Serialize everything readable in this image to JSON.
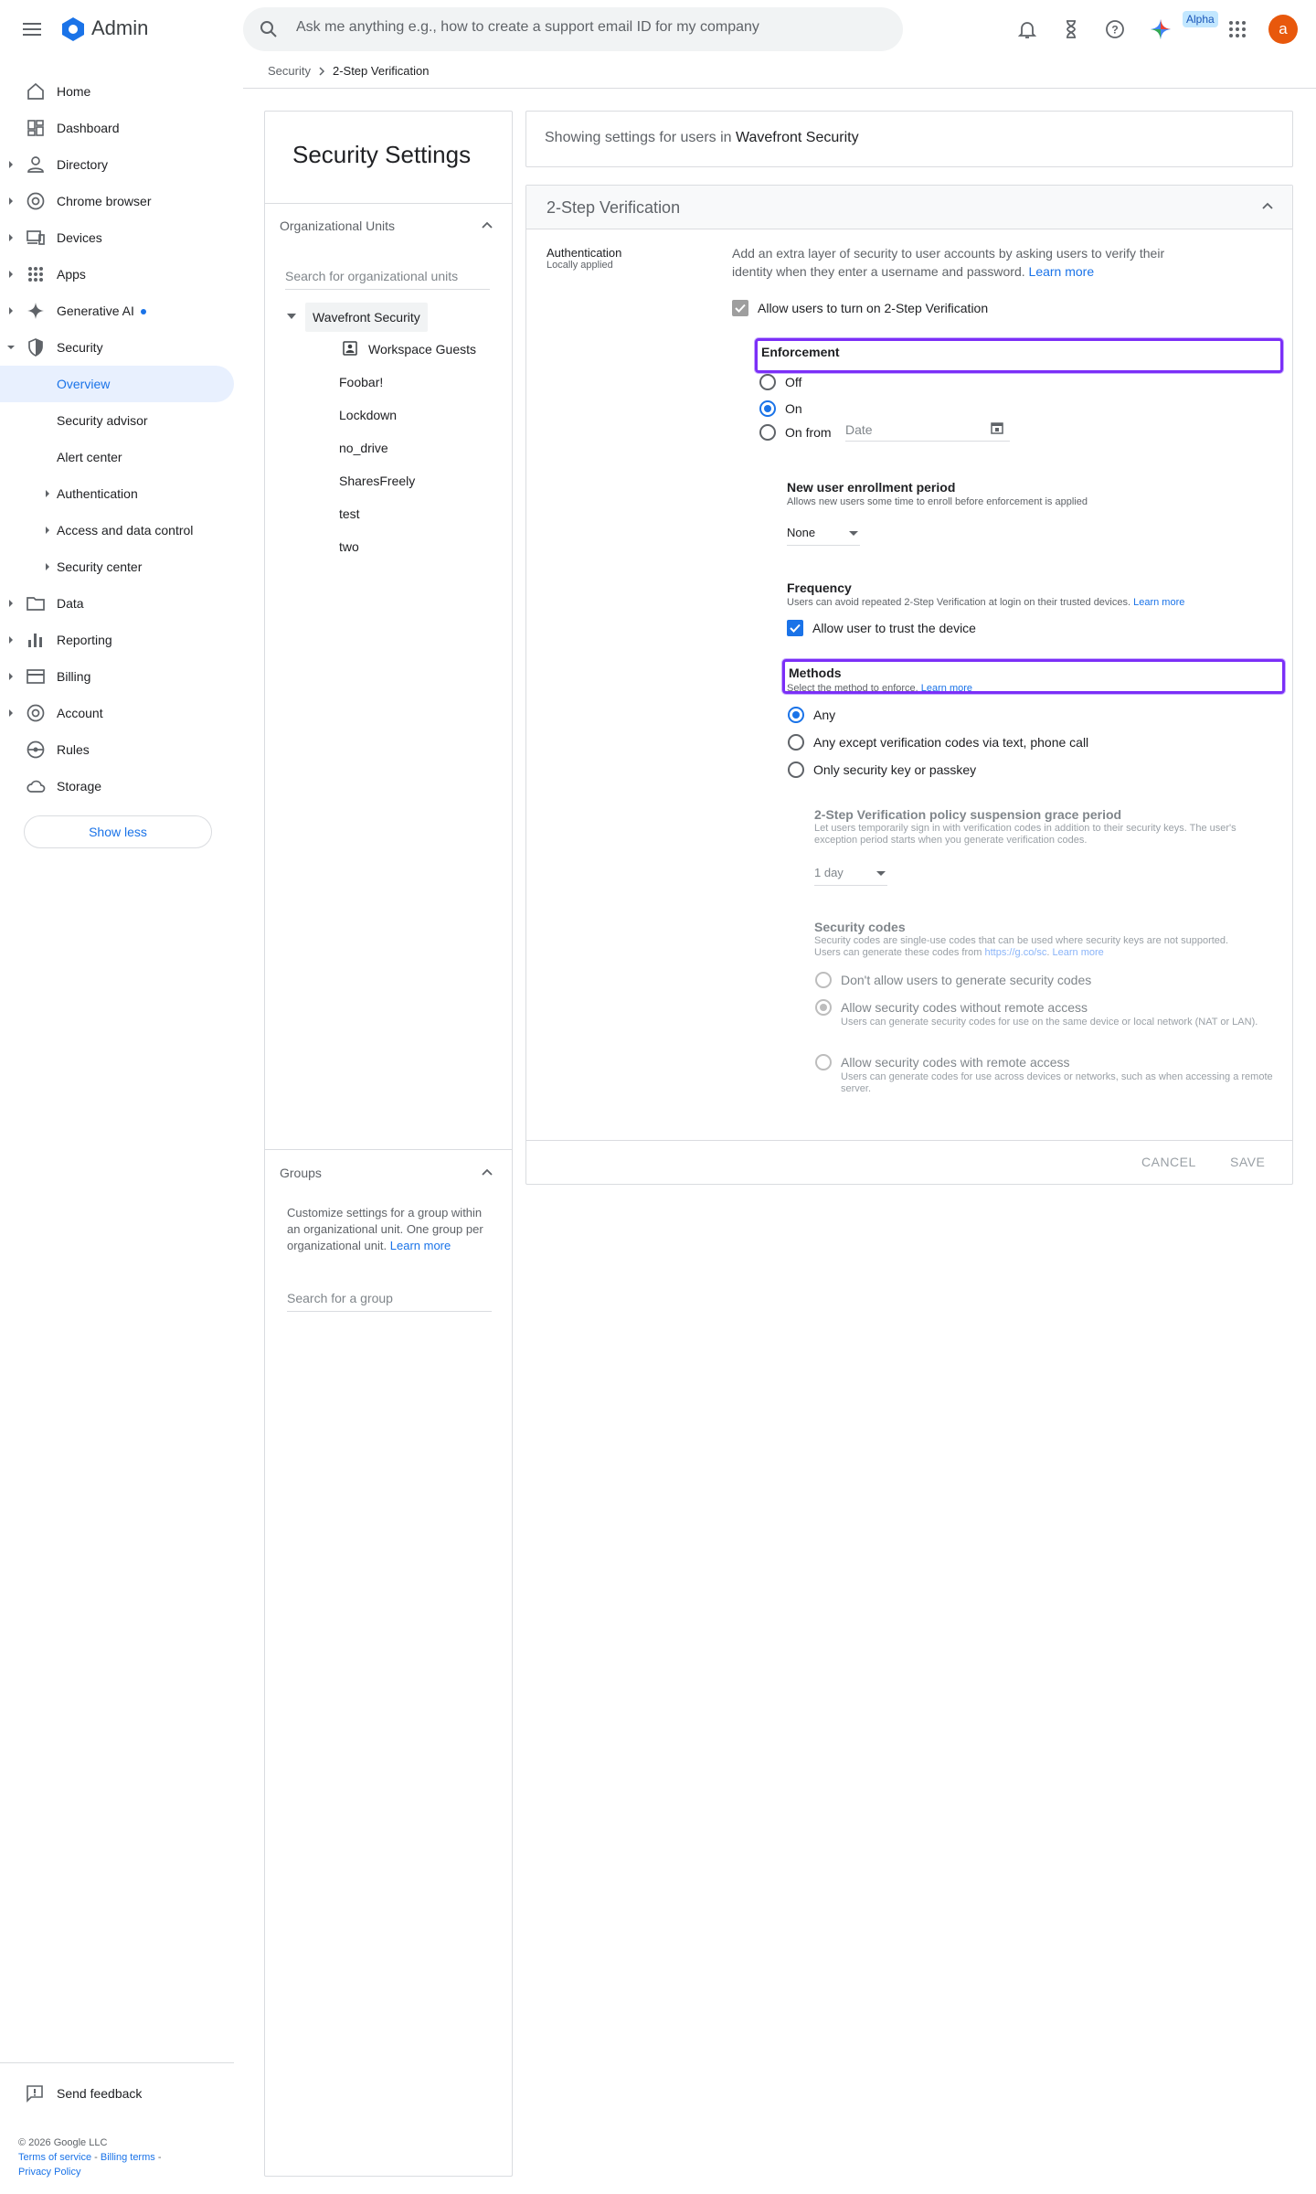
{
  "topbar": {
    "app_title": "Admin",
    "search_placeholder": "Ask me anything e.g., how to create a support email ID for my company",
    "alpha_badge": "Alpha",
    "avatar_letter": "a"
  },
  "breadcrumb": {
    "parent": "Security",
    "current": "2-Step Verification"
  },
  "sidebar": {
    "items": [
      {
        "label": "Home",
        "icon": "home-icon"
      },
      {
        "label": "Dashboard",
        "icon": "dashboard-icon"
      },
      {
        "label": "Directory",
        "icon": "person-icon"
      },
      {
        "label": "Chrome browser",
        "icon": "chrome-icon"
      },
      {
        "label": "Devices",
        "icon": "devices-icon"
      },
      {
        "label": "Apps",
        "icon": "apps-icon"
      },
      {
        "label": "Generative AI",
        "icon": "sparkle-icon"
      },
      {
        "label": "Security",
        "icon": "shield-icon"
      },
      {
        "label": "Overview"
      },
      {
        "label": "Security advisor"
      },
      {
        "label": "Alert center"
      },
      {
        "label": "Authentication"
      },
      {
        "label": "Access and data control"
      },
      {
        "label": "Security center"
      },
      {
        "label": "Data",
        "icon": "folder-icon"
      },
      {
        "label": "Reporting",
        "icon": "bar-chart-icon"
      },
      {
        "label": "Billing",
        "icon": "credit-card-icon"
      },
      {
        "label": "Account",
        "icon": "at-icon"
      },
      {
        "label": "Rules",
        "icon": "steering-icon"
      },
      {
        "label": "Storage",
        "icon": "cloud-icon"
      }
    ],
    "show_less": "Show less",
    "send_feedback": "Send feedback",
    "copyright": "© 2026 Google LLC",
    "terms": "Terms of service",
    "billing_terms": "Billing terms",
    "privacy": "Privacy Policy"
  },
  "ou_panel": {
    "title": "Security Settings",
    "ou_header": "Organizational Units",
    "search_placeholder": "Search for organizational units",
    "root": "Wavefront Security",
    "children": [
      "Workspace Guests",
      "Foobar!",
      "Lockdown",
      "no_drive",
      "SharesFreely",
      "test",
      "two"
    ],
    "groups_header": "Groups",
    "groups_text": "Customize settings for a group within an organizational unit. One group per organizational unit.",
    "groups_learn_more": "Learn more",
    "group_search_placeholder": "Search for a group"
  },
  "main": {
    "showing_prefix": "Showing settings for users in",
    "showing_ou": "Wavefront Security",
    "card_title": "2-Step Verification",
    "auth_label": "Authentication",
    "auth_sub": "Locally applied",
    "description": "Add an extra layer of security to user accounts by asking users to verify their identity when they enter a username and password.",
    "learn_more": "Learn more",
    "allow_label": "Allow users to turn on 2-Step Verification",
    "enforcement": {
      "title": "Enforcement",
      "options": [
        "Off",
        "On",
        "On from"
      ],
      "selected": "On",
      "date_placeholder": "Date"
    },
    "enrollment": {
      "title": "New user enrollment period",
      "sub": "Allows new users some time to enroll before enforcement is applied",
      "value": "None"
    },
    "frequency": {
      "title": "Frequency",
      "sub": "Users can avoid repeated 2-Step Verification at login on their trusted devices.",
      "learn_more": "Learn more",
      "trust_label": "Allow user to trust the device"
    },
    "methods": {
      "title": "Methods",
      "sub": "Select the method to enforce.",
      "learn_more": "Learn more",
      "options": [
        "Any",
        "Any except verification codes via text, phone call",
        "Only security key or passkey"
      ],
      "selected": "Any"
    },
    "grace": {
      "title": "2-Step Verification policy suspension grace period",
      "sub": "Let users temporarily sign in with verification codes in addition to their security keys. The user's exception period starts when you generate verification codes.",
      "value": "1 day"
    },
    "security_codes": {
      "title": "Security codes",
      "sub_prefix": "Security codes are single-use codes that can be used where security keys are not supported. Users can generate these codes from",
      "sub_link": "https://g.co/sc",
      "learn_more": "Learn more",
      "options": [
        {
          "label": "Don't allow users to generate security codes",
          "sub": ""
        },
        {
          "label": "Allow security codes without remote access",
          "sub": "Users can generate security codes for use on the same device or local network (NAT or LAN)."
        },
        {
          "label": "Allow security codes with remote access",
          "sub": "Users can generate codes for use across devices or networks, such as when accessing a remote server."
        }
      ],
      "selected": "Allow security codes without remote access"
    },
    "cancel": "CANCEL",
    "save": "SAVE"
  },
  "colors": {
    "accent": "#1a73e8",
    "highlight": "#7b2ff7",
    "avatar": "#e8580c"
  }
}
